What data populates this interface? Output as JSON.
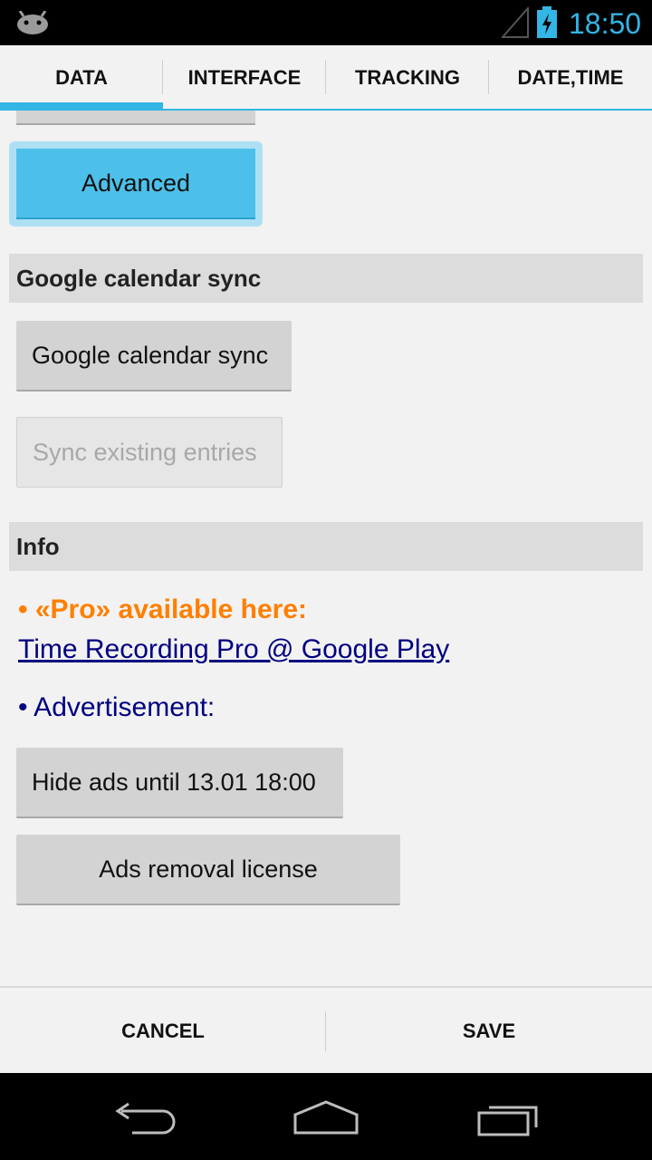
{
  "status_bar": {
    "time": "18:50",
    "icons": [
      "android-icon",
      "signal-icon",
      "battery-charging-icon"
    ]
  },
  "tabs": [
    {
      "label": "DATA",
      "active": true
    },
    {
      "label": "INTERFACE",
      "active": false
    },
    {
      "label": "TRACKING",
      "active": false
    },
    {
      "label": "DATE,TIME",
      "active": false
    }
  ],
  "content": {
    "advanced_button": "Advanced",
    "google_section": {
      "header": "Google calendar sync",
      "sync_button": "Google calendar sync",
      "sync_existing_button": "Sync existing entries"
    },
    "info_section": {
      "header": "Info",
      "pro_text": "• «Pro» available here:",
      "pro_link": "Time Recording Pro @ Google Play",
      "ad_text": "• Advertisement:",
      "hide_ads_button": "Hide ads until 13.01 18:00",
      "ads_license_button": "Ads removal license"
    }
  },
  "bottom_bar": {
    "cancel": "CANCEL",
    "save": "SAVE"
  },
  "nav_bar": {
    "icons": [
      "back-icon",
      "home-icon",
      "recent-apps-icon"
    ]
  },
  "colors": {
    "accent": "#33b5e5",
    "pro_orange": "#ff7f00",
    "link_navy": "#000080"
  }
}
